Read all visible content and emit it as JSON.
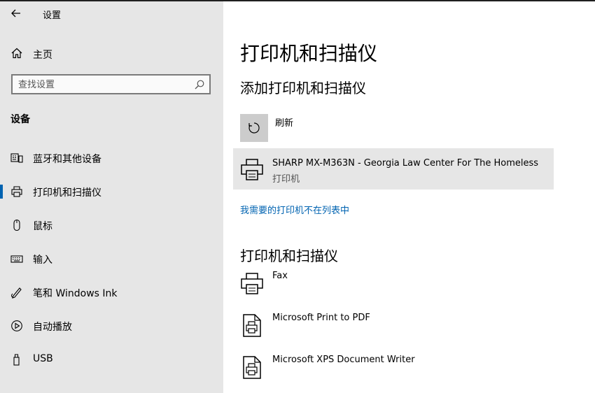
{
  "window": {
    "title": "设置"
  },
  "sidebar": {
    "home_label": "主页",
    "search_placeholder": "查找设置",
    "section_title": "设备",
    "items": [
      {
        "label": "蓝牙和其他设备",
        "icon": "bluetooth-devices-icon"
      },
      {
        "label": "打印机和扫描仪",
        "icon": "printer-icon",
        "active": true
      },
      {
        "label": "鼠标",
        "icon": "mouse-icon"
      },
      {
        "label": "输入",
        "icon": "keyboard-icon"
      },
      {
        "label": "笔和 Windows Ink",
        "icon": "pen-icon"
      },
      {
        "label": "自动播放",
        "icon": "autoplay-icon"
      },
      {
        "label": "USB",
        "icon": "usb-icon"
      }
    ]
  },
  "main": {
    "title": "打印机和扫描仪",
    "add_section_title": "添加打印机和扫描仪",
    "refresh_label": "刷新",
    "found_device": {
      "name": "SHARP MX-M363N - Georgia Law Center For The Homeless",
      "type": "打印机"
    },
    "missing_printer_link": "我需要的打印机不在列表中",
    "list_section_title": "打印机和扫描仪",
    "devices": [
      {
        "name": "Fax",
        "icon": "printer-icon"
      },
      {
        "name": "Microsoft Print to PDF",
        "icon": "document-printer-icon"
      },
      {
        "name": "Microsoft XPS Document Writer",
        "icon": "document-printer-icon"
      }
    ]
  },
  "colors": {
    "accent": "#0063b1",
    "sidebar_bg": "#e6e6e6",
    "selected_row_bg": "#e6e6e6",
    "refresh_tile_bg": "#cccccc"
  }
}
